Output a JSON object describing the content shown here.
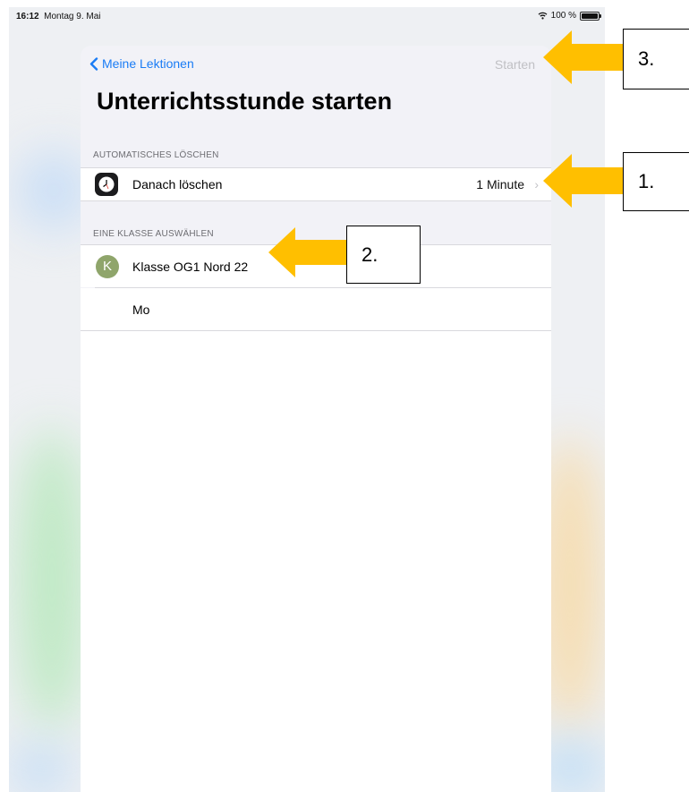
{
  "status_bar": {
    "time": "16:12",
    "date": "Montag 9. Mai",
    "battery": "100 %",
    "battery_level": 1.0
  },
  "nav": {
    "back_label": "Meine Lektionen",
    "start_label": "Starten"
  },
  "title": "Unterrichtsstunde starten",
  "auto_delete": {
    "header": "AUTOMATISCHES LÖSCHEN",
    "label": "Danach löschen",
    "value": "1 Minute"
  },
  "class_select": {
    "header": "EINE KLASSE AUSWÄHLEN",
    "items": [
      {
        "avatar": "K",
        "label": "Klasse OG1 Nord 22"
      },
      {
        "label": "Mo"
      }
    ]
  },
  "annotations": {
    "step1": "1.",
    "step2": "2.",
    "step3": "3.",
    "arrow_color": "#ffbf00"
  },
  "icons": [
    "chevron-left-icon",
    "clock-icon",
    "chevron-right-icon",
    "wifi-icon",
    "battery-icon",
    "arrow-left-icon"
  ]
}
